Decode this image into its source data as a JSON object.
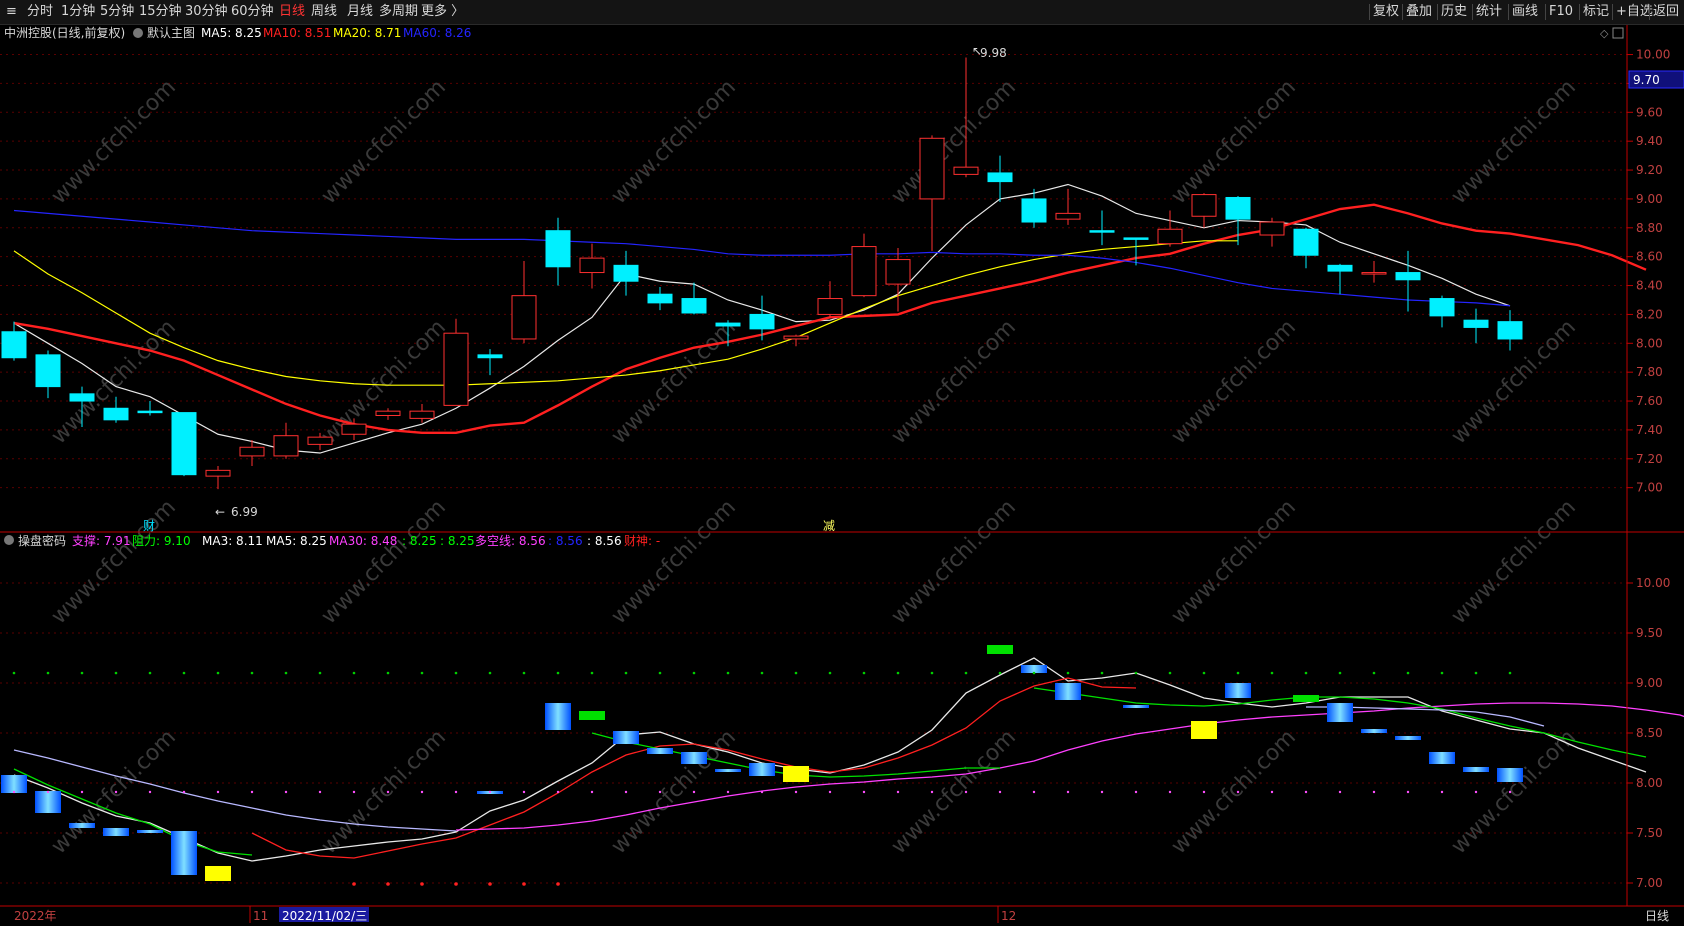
{
  "toolbar": {
    "left_items": [
      {
        "label": "分时",
        "active": false
      },
      {
        "label": "1分钟",
        "active": false
      },
      {
        "label": "5分钟",
        "active": false
      },
      {
        "label": "15分钟",
        "active": false
      },
      {
        "label": "30分钟",
        "active": false
      },
      {
        "label": "60分钟",
        "active": false
      },
      {
        "label": "日线",
        "active": true
      },
      {
        "label": "周线",
        "active": false
      },
      {
        "label": "月线",
        "active": false
      },
      {
        "label": "多周期",
        "active": false
      },
      {
        "label": "更多 〉",
        "active": false
      }
    ],
    "right_items": [
      "复权",
      "叠加",
      "历史",
      "统计",
      "画线",
      "F10",
      "标记",
      "+自选",
      "返回"
    ]
  },
  "main_panel": {
    "stock_title": "中洲控股(日线,前复权)",
    "template_label": "默认主图",
    "legend": [
      {
        "text": "MA5: 8.25",
        "color": "#ffffff"
      },
      {
        "text": "MA10: 8.51",
        "color": "#ff2020"
      },
      {
        "text": "MA20: 8.71",
        "color": "#ffff00"
      },
      {
        "text": "MA60: 8.26",
        "color": "#2424ff"
      }
    ],
    "y_ticks": [
      "10.00",
      "9.80",
      "9.60",
      "9.40",
      "9.20",
      "9.00",
      "8.80",
      "8.60",
      "8.40",
      "8.20",
      "8.00",
      "7.80",
      "7.60",
      "7.40",
      "7.20",
      "7.00"
    ],
    "current_price_label": "9.70",
    "high_annotation": "9.98",
    "low_annotation": "6.99",
    "markers": [
      "财",
      "减"
    ]
  },
  "sub_panel": {
    "indicator_name": "操盘密码",
    "legend": [
      {
        "text": "支撑: 7.91",
        "color": "#ff40ff"
      },
      {
        "text": "阻力: 9.10",
        "color": "#00ff00"
      },
      {
        "text": "MA3: 8.11",
        "color": "#ffffff"
      },
      {
        "text": "MA5: 8.25",
        "color": "#ffffff"
      },
      {
        "text": "MA30: 8.48",
        "color": "#ff40ff"
      },
      {
        "text": ": 8.25",
        "color": "#00ff00"
      },
      {
        "text": ": 8.25",
        "color": "#00ff00"
      },
      {
        "text": "多空线: 8.56",
        "color": "#ff40ff"
      },
      {
        "text": ": 8.56",
        "color": "#2424ff"
      },
      {
        "text": ": 8.56",
        "color": "#ffffff"
      },
      {
        "text": "财神: -",
        "color": "#ff2020"
      }
    ],
    "y_ticks": [
      "10.00",
      "9.50",
      "9.00",
      "8.50",
      "8.00",
      "7.50",
      "7.00"
    ]
  },
  "bottom_axis": {
    "labels": [
      "2022年",
      "11",
      "2022/11/02/三",
      "12"
    ],
    "period_button": "日线"
  },
  "watermark": "www.cfchi.com",
  "chart_data": [
    {
      "type": "candlestick",
      "title": "中洲控股(日线,前复权)",
      "ylim": [
        6.88,
        10.08
      ],
      "candles": [
        {
          "o": 8.08,
          "h": 8.15,
          "l": 7.88,
          "c": 7.9
        },
        {
          "o": 7.92,
          "h": 7.95,
          "l": 7.62,
          "c": 7.7
        },
        {
          "o": 7.65,
          "h": 7.7,
          "l": 7.42,
          "c": 7.6
        },
        {
          "o": 7.55,
          "h": 7.63,
          "l": 7.45,
          "c": 7.47
        },
        {
          "o": 7.53,
          "h": 7.6,
          "l": 7.5,
          "c": 7.52
        },
        {
          "o": 7.52,
          "h": 7.52,
          "l": 7.08,
          "c": 7.09
        },
        {
          "o": 7.08,
          "h": 7.15,
          "l": 6.99,
          "c": 7.12
        },
        {
          "o": 7.22,
          "h": 7.33,
          "l": 7.15,
          "c": 7.28
        },
        {
          "o": 7.22,
          "h": 7.45,
          "l": 7.2,
          "c": 7.36
        },
        {
          "o": 7.3,
          "h": 7.38,
          "l": 7.26,
          "c": 7.35
        },
        {
          "o": 7.37,
          "h": 7.48,
          "l": 7.33,
          "c": 7.44
        },
        {
          "o": 7.5,
          "h": 7.55,
          "l": 7.47,
          "c": 7.53
        },
        {
          "o": 7.48,
          "h": 7.58,
          "l": 7.45,
          "c": 7.53
        },
        {
          "o": 7.57,
          "h": 8.17,
          "l": 7.57,
          "c": 8.07
        },
        {
          "o": 7.92,
          "h": 7.96,
          "l": 7.78,
          "c": 7.9
        },
        {
          "o": 8.03,
          "h": 8.57,
          "l": 8.0,
          "c": 8.33
        },
        {
          "o": 8.78,
          "h": 8.87,
          "l": 8.4,
          "c": 8.53
        },
        {
          "o": 8.49,
          "h": 8.69,
          "l": 8.38,
          "c": 8.59
        },
        {
          "o": 8.54,
          "h": 8.64,
          "l": 8.33,
          "c": 8.43
        },
        {
          "o": 8.34,
          "h": 8.39,
          "l": 8.23,
          "c": 8.28
        },
        {
          "o": 8.31,
          "h": 8.42,
          "l": 8.2,
          "c": 8.21
        },
        {
          "o": 8.14,
          "h": 8.16,
          "l": 7.98,
          "c": 8.12
        },
        {
          "o": 8.2,
          "h": 8.33,
          "l": 8.02,
          "c": 8.1
        },
        {
          "o": 8.03,
          "h": 8.06,
          "l": 7.98,
          "c": 8.05
        },
        {
          "o": 8.2,
          "h": 8.43,
          "l": 8.18,
          "c": 8.31
        },
        {
          "o": 8.33,
          "h": 8.76,
          "l": 8.32,
          "c": 8.67
        },
        {
          "o": 8.41,
          "h": 8.66,
          "l": 8.22,
          "c": 8.58
        },
        {
          "o": 9.0,
          "h": 9.44,
          "l": 8.64,
          "c": 9.42
        },
        {
          "o": 9.17,
          "h": 9.98,
          "l": 9.15,
          "c": 9.22
        },
        {
          "o": 9.18,
          "h": 9.3,
          "l": 8.98,
          "c": 9.12
        },
        {
          "o": 9.0,
          "h": 9.07,
          "l": 8.8,
          "c": 8.84
        },
        {
          "o": 8.86,
          "h": 9.07,
          "l": 8.82,
          "c": 8.9
        },
        {
          "o": 8.78,
          "h": 8.92,
          "l": 8.68,
          "c": 8.77
        },
        {
          "o": 8.73,
          "h": 8.73,
          "l": 8.54,
          "c": 8.72
        },
        {
          "o": 8.69,
          "h": 8.92,
          "l": 8.67,
          "c": 8.79
        },
        {
          "o": 8.88,
          "h": 9.04,
          "l": 8.8,
          "c": 9.03
        },
        {
          "o": 9.01,
          "h": 9.02,
          "l": 8.68,
          "c": 8.86
        },
        {
          "o": 8.75,
          "h": 8.87,
          "l": 8.67,
          "c": 8.84
        },
        {
          "o": 8.79,
          "h": 8.8,
          "l": 8.52,
          "c": 8.61
        },
        {
          "o": 8.54,
          "h": 8.55,
          "l": 8.34,
          "c": 8.5
        },
        {
          "o": 8.49,
          "h": 8.57,
          "l": 8.42,
          "c": 8.49
        },
        {
          "o": 8.49,
          "h": 8.64,
          "l": 8.22,
          "c": 8.44
        },
        {
          "o": 8.31,
          "h": 8.33,
          "l": 8.11,
          "c": 8.19
        },
        {
          "o": 8.16,
          "h": 8.24,
          "l": 8.0,
          "c": 8.11
        },
        {
          "o": 8.15,
          "h": 8.23,
          "l": 7.95,
          "c": 8.03
        }
      ],
      "series": [
        {
          "name": "MA5",
          "color": "#e8e8e8",
          "values": [
            8.14,
            8.0,
            7.86,
            7.7,
            7.63,
            7.5,
            7.37,
            7.32,
            7.26,
            7.24,
            7.31,
            7.38,
            7.44,
            7.55,
            7.69,
            7.84,
            8.02,
            8.18,
            8.48,
            8.43,
            8.41,
            8.3,
            8.23,
            8.15,
            8.16,
            8.23,
            8.34,
            8.59,
            8.82,
            9.0,
            9.04,
            9.1,
            9.02,
            8.9,
            8.85,
            8.8,
            8.85,
            8.84,
            8.82,
            8.7,
            8.62,
            8.54,
            8.45,
            8.34,
            8.26
          ]
        },
        {
          "name": "MA10",
          "color": "#ff2020",
          "values": [
            8.14,
            8.1,
            8.05,
            8.0,
            7.95,
            7.88,
            7.78,
            7.68,
            7.58,
            7.5,
            7.44,
            7.4,
            7.38,
            7.38,
            7.43,
            7.45,
            7.57,
            7.7,
            7.82,
            7.9,
            7.97,
            8.01,
            8.06,
            8.12,
            8.18,
            8.19,
            8.2,
            8.28,
            8.33,
            8.38,
            8.43,
            8.49,
            8.54,
            8.59,
            8.62,
            8.69,
            8.75,
            8.79,
            8.86,
            8.93,
            8.96,
            8.9,
            8.83,
            8.78,
            8.76,
            8.72,
            8.68,
            8.61,
            8.51
          ]
        },
        {
          "name": "MA20",
          "color": "#ffff00",
          "values": [
            8.64,
            8.48,
            8.35,
            8.21,
            8.07,
            7.97,
            7.88,
            7.82,
            7.77,
            7.74,
            7.72,
            7.71,
            7.71,
            7.71,
            7.72,
            7.73,
            7.74,
            7.76,
            7.78,
            7.81,
            7.85,
            7.89,
            7.96,
            8.04,
            8.14,
            8.24,
            8.33,
            8.4,
            8.47,
            8.53,
            8.58,
            8.62,
            8.65,
            8.67,
            8.69,
            8.71,
            8.71
          ]
        },
        {
          "name": "MA60",
          "color": "#2424ff",
          "values": [
            8.92,
            8.9,
            8.88,
            8.86,
            8.84,
            8.82,
            8.8,
            8.78,
            8.77,
            8.76,
            8.75,
            8.74,
            8.73,
            8.72,
            8.72,
            8.72,
            8.71,
            8.7,
            8.69,
            8.67,
            8.65,
            8.62,
            8.61,
            8.61,
            8.61,
            8.62,
            8.62,
            8.63,
            8.62,
            8.62,
            8.61,
            8.61,
            8.59,
            8.56,
            8.52,
            8.47,
            8.42,
            8.38,
            8.36,
            8.34,
            8.32,
            8.3,
            8.29,
            8.28,
            8.26
          ]
        }
      ]
    },
    {
      "type": "indicator",
      "title": "操盘密码",
      "ylim": [
        6.78,
        10.28
      ],
      "bars": [
        {
          "top": 8.08,
          "bottom": 7.9,
          "kind": "blue"
        },
        {
          "top": 7.92,
          "bottom": 7.7,
          "kind": "blue"
        },
        {
          "top": 7.6,
          "bottom": 7.55,
          "kind": "blue"
        },
        {
          "top": 7.55,
          "bottom": 7.47,
          "kind": "blue"
        },
        {
          "top": 7.53,
          "bottom": 7.5,
          "kind": "blue"
        },
        {
          "top": 7.52,
          "bottom": 7.08,
          "kind": "blue"
        },
        {
          "top": 7.17,
          "bottom": 7.02,
          "kind": "yellow"
        },
        null,
        null,
        null,
        null,
        null,
        null,
        null,
        {
          "top": 7.92,
          "bottom": 7.89,
          "kind": "blue"
        },
        null,
        {
          "top": 8.8,
          "bottom": 8.53,
          "kind": "blue"
        },
        {
          "top": 8.72,
          "bottom": 8.63,
          "kind": "green"
        },
        {
          "top": 8.52,
          "bottom": 8.39,
          "kind": "blue"
        },
        {
          "top": 8.35,
          "bottom": 8.29,
          "kind": "blue"
        },
        {
          "top": 8.31,
          "bottom": 8.19,
          "kind": "blue"
        },
        {
          "top": 8.14,
          "bottom": 8.11,
          "kind": "blue"
        },
        {
          "top": 8.2,
          "bottom": 8.07,
          "kind": "blue"
        },
        {
          "top": 8.17,
          "bottom": 8.01,
          "kind": "yellow"
        },
        null,
        null,
        null,
        null,
        null,
        {
          "top": 9.38,
          "bottom": 9.29,
          "kind": "green"
        },
        {
          "top": 9.18,
          "bottom": 9.1,
          "kind": "blue"
        },
        {
          "top": 9.0,
          "bottom": 8.83,
          "kind": "blue"
        },
        null,
        {
          "top": 8.78,
          "bottom": 8.75,
          "kind": "blue"
        },
        null,
        {
          "top": 8.62,
          "bottom": 8.44,
          "kind": "yellow"
        },
        {
          "top": 9.0,
          "bottom": 8.85,
          "kind": "blue"
        },
        null,
        {
          "top": 8.88,
          "bottom": 8.81,
          "kind": "green"
        },
        {
          "top": 8.8,
          "bottom": 8.61,
          "kind": "blue"
        },
        {
          "top": 8.54,
          "bottom": 8.5,
          "kind": "blue"
        },
        {
          "top": 8.47,
          "bottom": 8.43,
          "kind": "blue"
        },
        {
          "top": 8.31,
          "bottom": 8.19,
          "kind": "blue"
        },
        {
          "top": 8.16,
          "bottom": 8.11,
          "kind": "blue"
        },
        {
          "top": 8.15,
          "bottom": 8.01,
          "kind": "blue"
        }
      ],
      "series": [
        {
          "name": "MA3",
          "color": "#e8e8e8",
          "values": [
            8.08,
            7.95,
            7.8,
            7.67,
            7.6,
            7.45,
            7.3,
            7.22,
            7.27,
            7.33,
            7.37,
            7.41,
            7.44,
            7.51,
            7.72,
            7.83,
            8.02,
            8.2,
            8.48,
            8.51,
            8.39,
            8.31,
            8.2,
            8.14,
            8.1,
            8.18,
            8.31,
            8.53,
            8.9,
            9.08,
            9.25,
            9.02,
            9.05,
            9.1,
            8.98,
            8.85,
            8.8,
            8.76,
            8.8,
            8.86,
            8.86,
            8.86,
            8.72,
            8.63,
            8.54,
            8.5,
            8.35,
            8.23,
            8.11
          ]
        },
        {
          "name": "MA5",
          "color": "#ff2020",
          "values": [
            7.5,
            7.33,
            7.27,
            7.25,
            7.32,
            7.39,
            7.45,
            7.58,
            7.71,
            7.9,
            8.11,
            8.28,
            8.37,
            8.39,
            8.33,
            8.24,
            8.16,
            8.11,
            8.15,
            8.25,
            8.38,
            8.55,
            8.82,
            8.97,
            9.05,
            8.96,
            8.95
          ]
        },
        {
          "name": "MA30",
          "color": "#ff40ff",
          "values": [
            7.53,
            7.54,
            7.55,
            7.58,
            7.62,
            7.68,
            7.75,
            7.81,
            7.87,
            7.92,
            7.96,
            7.99,
            8.01,
            8.04,
            8.06,
            8.09,
            8.15,
            8.22,
            8.33,
            8.42,
            8.49,
            8.54,
            8.59,
            8.63,
            8.66,
            8.68,
            8.7,
            8.72,
            8.75,
            8.77,
            8.79,
            8.8,
            8.8,
            8.79,
            8.77,
            8.73,
            8.68,
            8.56
          ]
        },
        {
          "name": "多空线",
          "color": "#b8b8ff",
          "values": [
            8.33,
            8.25,
            8.16,
            8.07,
            7.99,
            7.9,
            7.82,
            7.75,
            7.68,
            7.63,
            7.59,
            7.56,
            7.54,
            7.52
          ]
        },
        {
          "name": "阻力线",
          "color": "#00e000",
          "values": [
            8.14,
            7.98,
            7.84,
            7.7,
            7.59,
            7.42,
            7.31,
            7.28
          ]
        },
        {
          "name": "green2",
          "color": "#00e000",
          "values": [
            8.5,
            8.41,
            8.34,
            8.27,
            8.2,
            8.13,
            8.08,
            8.06,
            8.07,
            8.09,
            8.12,
            8.15,
            8.15
          ]
        },
        {
          "name": "green3",
          "color": "#00e000",
          "values": [
            8.95,
            8.9,
            8.85,
            8.8,
            8.78,
            8.77,
            8.79,
            8.83,
            8.86,
            8.86,
            8.84,
            8.8,
            8.74,
            8.65,
            8.57,
            8.5,
            8.41,
            8.33,
            8.26
          ]
        },
        {
          "name": "蓝线",
          "color": "#b8b8ff",
          "values": [
            8.76,
            8.76,
            8.75,
            8.74,
            8.73,
            8.71,
            8.66,
            8.57
          ]
        }
      ]
    }
  ]
}
